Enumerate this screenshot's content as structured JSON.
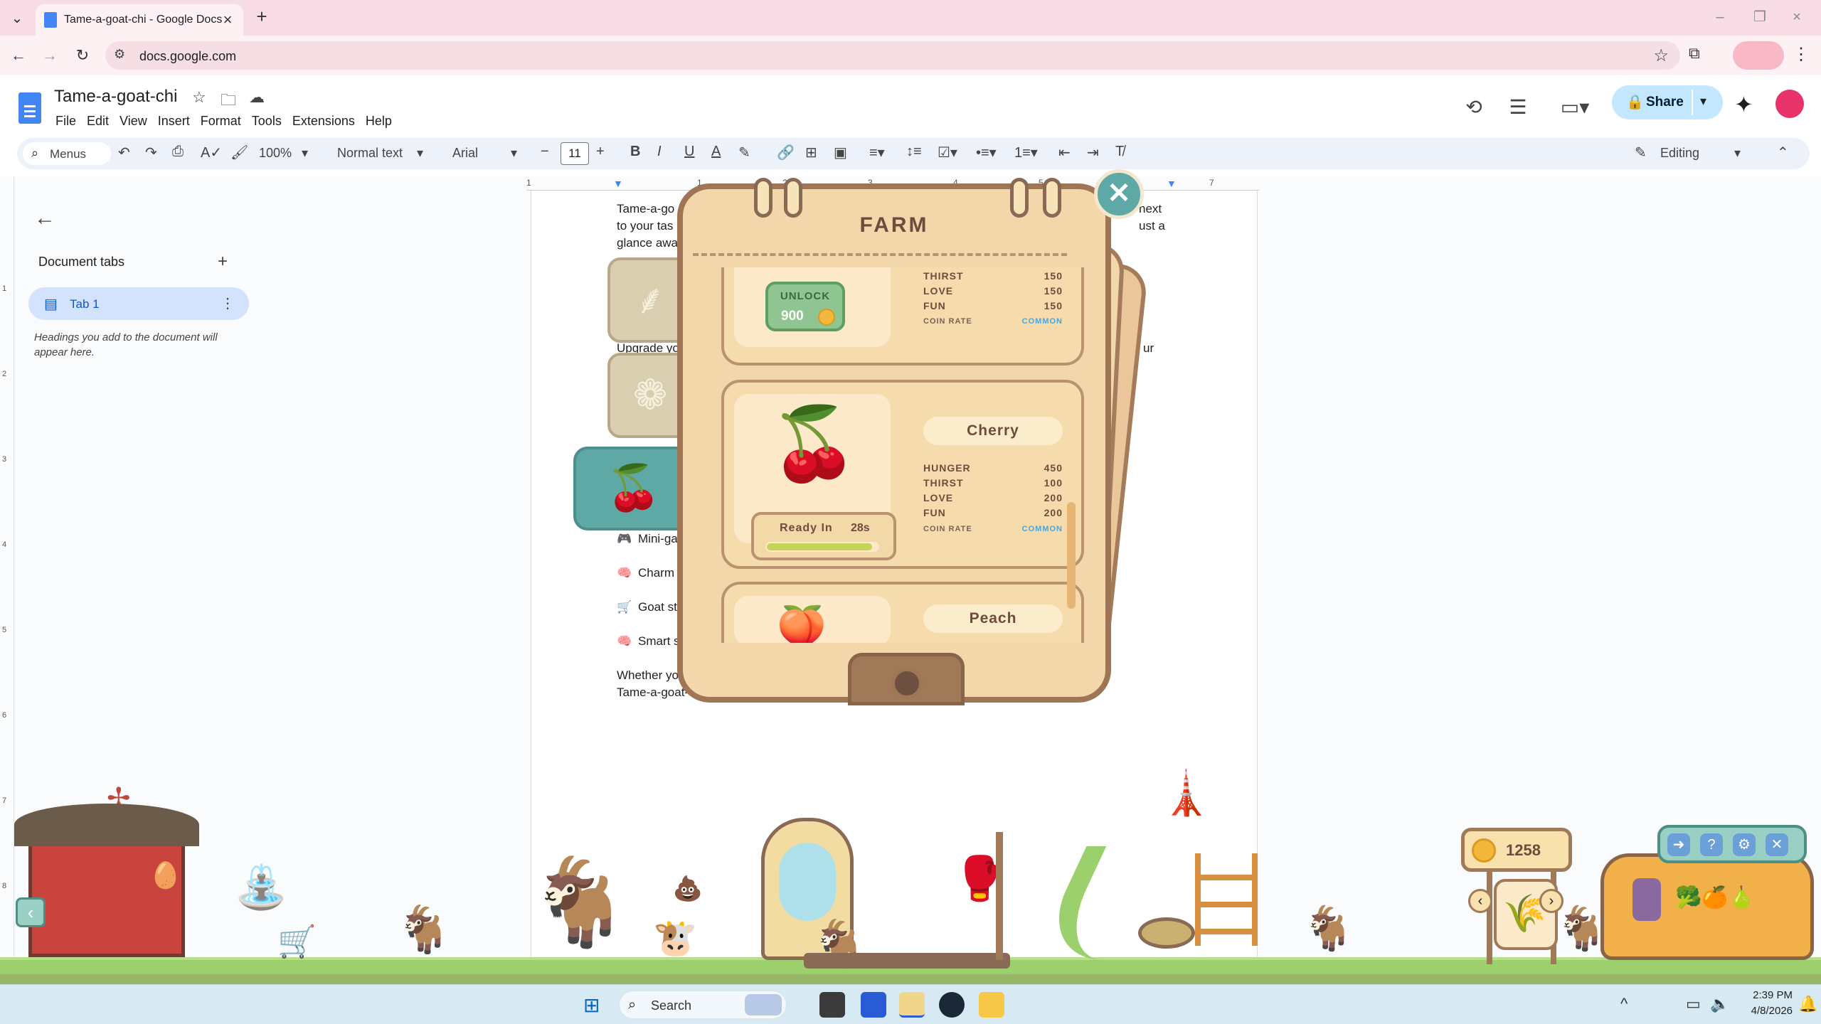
{
  "browser": {
    "tab_title": "Tame-a-goat-chi - Google Docs",
    "new_tab_icon": "plus-icon",
    "url": "docs.google.com"
  },
  "docs": {
    "title": "Tame-a-goat-chi",
    "menu": [
      "File",
      "Edit",
      "View",
      "Insert",
      "Format",
      "Tools",
      "Extensions",
      "Help"
    ],
    "share_label": "Share",
    "avatar_color": "#e8336a",
    "toolbar": {
      "search_label": "Menus",
      "zoom": "100%",
      "style": "Normal text",
      "font": "Arial",
      "font_size": "11",
      "mode": "Editing"
    },
    "ruler_numbers": [
      "1",
      "1",
      "2",
      "3",
      "4",
      "5",
      "6",
      "7"
    ],
    "ruler_left_numbers": [
      "1",
      "2",
      "3",
      "4",
      "5",
      "6",
      "7",
      "8"
    ]
  },
  "outline": {
    "tabs_label": "Document tabs",
    "tab1_label": "Tab 1",
    "hint": "Headings you add to the document will appear here."
  },
  "doc_body": {
    "lines": [
      "Tame-a-go",
      "to your tas",
      "glance awa",
      "Upgrade yo",
      "Mini-ga",
      "Charm",
      "Goat st",
      "Smart s",
      "Whether yo",
      "Tame-a-goat-c"
    ],
    "right_fragments": [
      "next",
      "ust a",
      "ur"
    ],
    "emoji": [
      "🎮",
      "🧠",
      "🛒",
      "🧠"
    ]
  },
  "farm": {
    "title": "FARM",
    "close_icon": "close-icon",
    "categories": [
      "wheat-icon",
      "cauliflower-icon",
      "cherry-icon"
    ],
    "locked_card": {
      "unlock_label": "UNLOCK",
      "unlock_price": "900",
      "stats": [
        {
          "label": "THIRST",
          "value": "150"
        },
        {
          "label": "LOVE",
          "value": "150"
        },
        {
          "label": "FUN",
          "value": "150"
        }
      ],
      "coin_rate_label": "COIN RATE",
      "coin_rate_value": "COMMON"
    },
    "cherry_card": {
      "name": "Cherry",
      "ready_label": "Ready In",
      "ready_time": "28s",
      "progress": 0.95,
      "stats": [
        {
          "label": "HUNGER",
          "value": "450"
        },
        {
          "label": "THIRST",
          "value": "100"
        },
        {
          "label": "LOVE",
          "value": "200"
        },
        {
          "label": "FUN",
          "value": "200"
        }
      ],
      "coin_rate_label": "COIN RATE",
      "coin_rate_value": "COMMON"
    },
    "peach_card": {
      "name": "Peach"
    },
    "coins": "1258",
    "colors": {
      "panel_border": "#9f7655",
      "panel_fill": "#f3d7aa",
      "accent_teal": "#5ea8a6",
      "rate_blue": "#4ea3d8"
    }
  },
  "taskbar": {
    "search_label": "Search",
    "time": "2:39 PM",
    "date": "4/8/2026"
  }
}
